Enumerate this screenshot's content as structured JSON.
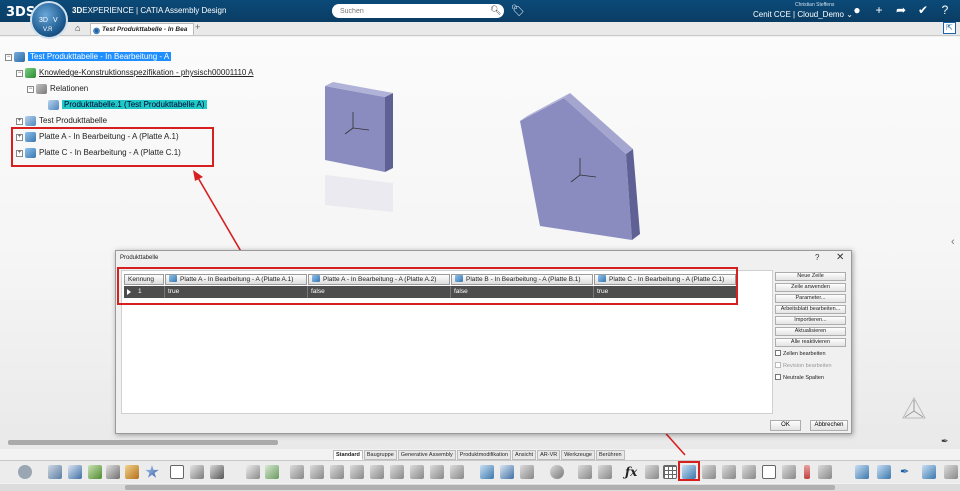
{
  "app": {
    "logo": "3DS",
    "brand_bold": "3D",
    "brand_rest": "EXPERIENCE | CATIA Assembly Design",
    "compass_3d": "3D",
    "compass_v": "V",
    "compass_version": "V.R",
    "search_placeholder": "Suchen",
    "user_name": "Christian Steffens",
    "tenant": "Cenit CCE | Cloud_Demo ⌄"
  },
  "tab": {
    "doc_title": "Test Produkttabelle - In Bea",
    "plus": "+"
  },
  "tree": {
    "root": "Test Produkttabelle - In Bearbeitung - A",
    "knowledge": "Knowledge-Konstruktionsspezifikation - physisch00001110 A",
    "relationen": "Relationen",
    "produkttabelle_rel": "Produkttabelle.1 (Test Produkttabelle A)",
    "test_produkttabelle": "Test Produkttabelle",
    "platte_a": "Platte A - In Bearbeitung - A (Platte A.1)",
    "platte_c": "Platte C - In Bearbeitung - A (Platte C.1)"
  },
  "dialog": {
    "title": "Produkttabelle",
    "help": "?",
    "close": "✕",
    "columns": [
      "Kennung",
      "Platte A - In Bearbeitung - A (Platte A.1)",
      "Platte A - In Bearbeitung - A (Platte A.2)",
      "Platte B - In Bearbeitung - A (Platte B.1)",
      "Platte C - In Bearbeitung - A (Platte C.1)"
    ],
    "row": [
      "1",
      "true",
      "false",
      "false",
      "true"
    ],
    "buttons": {
      "neue_zeile": "Neue Zeile",
      "zeile_anwenden": "Zeile anwenden",
      "parameter": "Parameter...",
      "arbeitsblatt": "Arbeitsblatt bearbeiten...",
      "importieren": "Importieren...",
      "aktualisieren": "Aktualisieren",
      "alle_reaktivieren": "Alle reaktivieren"
    },
    "checkboxes": {
      "zellen": "Zellen bearbeiten",
      "revision": "Revision bearbeiten",
      "neutrale": "Neutrale Spalten"
    },
    "ok": "OK",
    "cancel": "Abbrechen"
  },
  "workbench_tabs": [
    "Standard",
    "Baugruppe",
    "Generative Assembly",
    "Produktmodifikation",
    "Ansicht",
    "AR-VR",
    "Werkzeuge",
    "Berühren"
  ],
  "colors": {
    "highlight_red": "#d62020",
    "selection_blue": "#1f8fff",
    "relation_cyan": "#1fc9c6",
    "part_purple": "#7c7fb4"
  }
}
